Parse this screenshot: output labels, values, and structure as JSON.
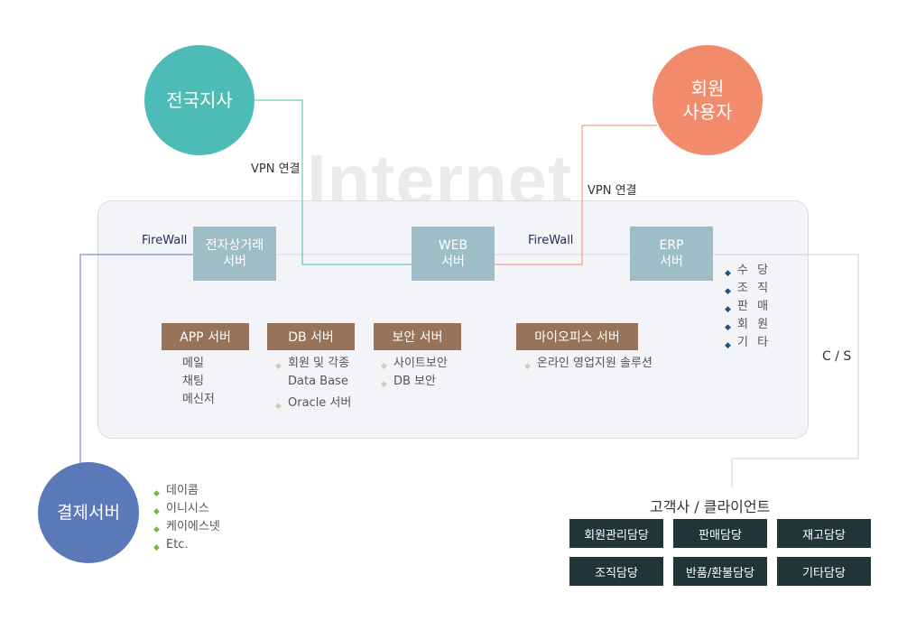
{
  "watermark": "Internet",
  "nodes": {
    "branch": {
      "label": "전국지사",
      "color": "#4dbcb6"
    },
    "member": {
      "label": "회원\n사용자",
      "color": "#f28b6b"
    },
    "payment": {
      "label": "결제서버",
      "color": "#5b78b8"
    }
  },
  "connections": {
    "vpn_left": "VPN 연결",
    "vpn_right": "VPN 연결",
    "firewall_left": "FireWall",
    "firewall_right": "FireWall",
    "cs": "C / S"
  },
  "servers": {
    "ecommerce": "전자상거래\n서버",
    "web": "WEB\n서버",
    "erp": "ERP\n서버"
  },
  "erp_items": [
    "수 당",
    "조 직",
    "판 매",
    "회 원",
    "기 타"
  ],
  "sub_servers": [
    {
      "title": "APP 서버",
      "items": [
        "메일",
        "채팅",
        "메신저"
      ]
    },
    {
      "title": "DB 서버",
      "items": [
        "회원 및 각종\nData Base",
        "Oracle 서버"
      ]
    },
    {
      "title": "보안 서버",
      "items": [
        "사이트보안",
        "DB 보안"
      ]
    },
    {
      "title": "마이오피스 서버",
      "items": [
        "온라인 영업지원 솔루션"
      ]
    }
  ],
  "payment_items": [
    "데이콤",
    "이니시스",
    "케이에스넷",
    "Etc."
  ],
  "client": {
    "title": "고객사 / 클라이언트",
    "roles": [
      "회원관리담당",
      "판매담당",
      "재고담당",
      "조직담당",
      "반품/환불담당",
      "기타담당"
    ]
  },
  "bullet_glyph": "◆"
}
